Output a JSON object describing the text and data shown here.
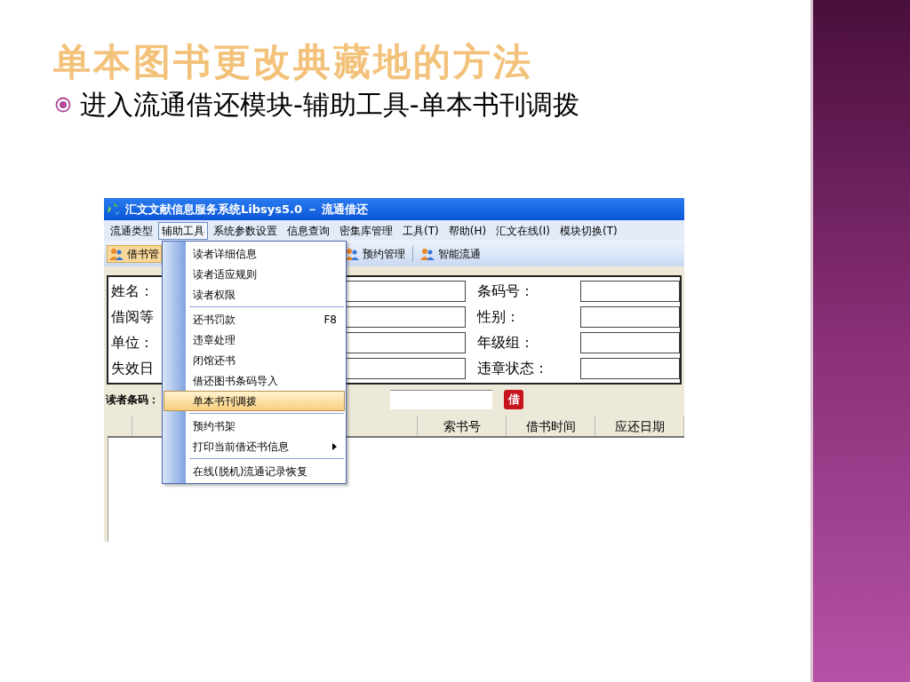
{
  "slide": {
    "title": "单本图书更改典藏地的方法",
    "bullets": [
      "进入流通借还模块-辅助工具-单本书刊调拨"
    ]
  },
  "app": {
    "title": "汇文文献信息服务系统Libsys5.0 － 流通借还",
    "menubar": [
      {
        "label": "流通类型",
        "selected": false
      },
      {
        "label": "辅助工具",
        "selected": true
      },
      {
        "label": "系统参数设置",
        "selected": false
      },
      {
        "label": "信息查询",
        "selected": false
      },
      {
        "label": "密集库管理",
        "selected": false
      },
      {
        "label": "工具(T)",
        "selected": false
      },
      {
        "label": "帮助(H)",
        "selected": false
      },
      {
        "label": "汇文在线(I)",
        "selected": false
      },
      {
        "label": "模块切换(T)",
        "selected": false
      }
    ],
    "toolbar": [
      {
        "label": "借书管"
      },
      {
        "label": "预约管理"
      },
      {
        "label": "智能流通"
      }
    ],
    "form_left_labels": [
      "姓名：",
      "借阅等",
      "单位：",
      "失效日"
    ],
    "form_right_labels": [
      "条码号：",
      "性别：",
      "年级组：",
      "违章状态："
    ],
    "reader_barcode_label": "读者条码：",
    "borrow_button": "借",
    "table_columns": [
      "索书号",
      "借书时间",
      "应还日期"
    ],
    "dropdown": [
      {
        "label": "读者详细信息",
        "selected": false,
        "separator_before": false,
        "submenu": false
      },
      {
        "label": "读者适应规则",
        "selected": false,
        "separator_before": false,
        "submenu": false
      },
      {
        "label": "读者权限",
        "selected": false,
        "separator_before": false,
        "submenu": false
      },
      {
        "label": "还书罚款",
        "shortcut": "F8",
        "selected": false,
        "separator_before": true,
        "submenu": false
      },
      {
        "label": "违章处理",
        "selected": false,
        "separator_before": false,
        "submenu": false
      },
      {
        "label": "闭馆还书",
        "selected": false,
        "separator_before": false,
        "submenu": false
      },
      {
        "label": "借还图书条码导入",
        "selected": false,
        "separator_before": false,
        "submenu": false
      },
      {
        "label": "单本书刊调拨",
        "selected": true,
        "separator_before": false,
        "submenu": false
      },
      {
        "label": "预约书架",
        "selected": false,
        "separator_before": true,
        "submenu": false
      },
      {
        "label": "打印当前借还书信息",
        "selected": false,
        "separator_before": false,
        "submenu": true
      },
      {
        "label": "在线(脱机)流通记录恢复",
        "selected": false,
        "separator_before": true,
        "submenu": false
      }
    ]
  }
}
